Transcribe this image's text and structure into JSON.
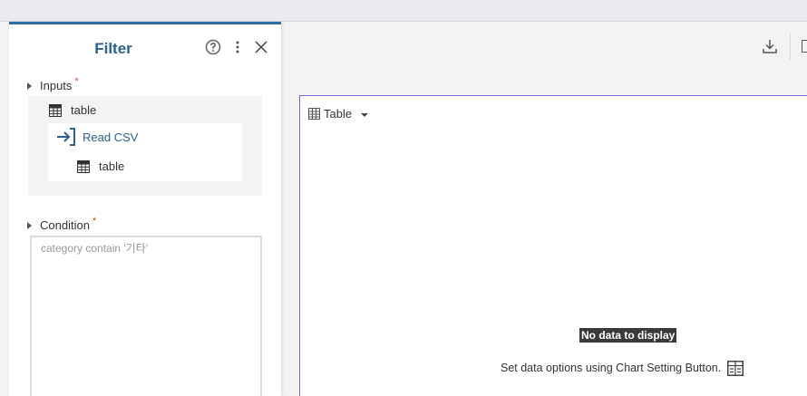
{
  "filter_panel": {
    "title": "Filter",
    "icons": {
      "help": "help-circle-icon",
      "more": "more-vertical-icon",
      "close": "close-icon"
    },
    "inputs": {
      "label": "Inputs",
      "required_mark": "*",
      "source_table": "table",
      "step_name": "Read CSV",
      "step_output": "table"
    },
    "condition": {
      "label": "Condition",
      "required_mark": "*",
      "value": "category contain '기타'"
    }
  },
  "chart": {
    "type_label": "Table",
    "empty_message": "No data to display",
    "hint": "Set data options using Chart Setting Button."
  },
  "toolbar": {
    "download_icon": "download-icon"
  },
  "colors": {
    "accent": "#2f6ea0",
    "title": "#2b5f8e",
    "required": "#e0463c",
    "chart_border": "#6f6fd0"
  }
}
